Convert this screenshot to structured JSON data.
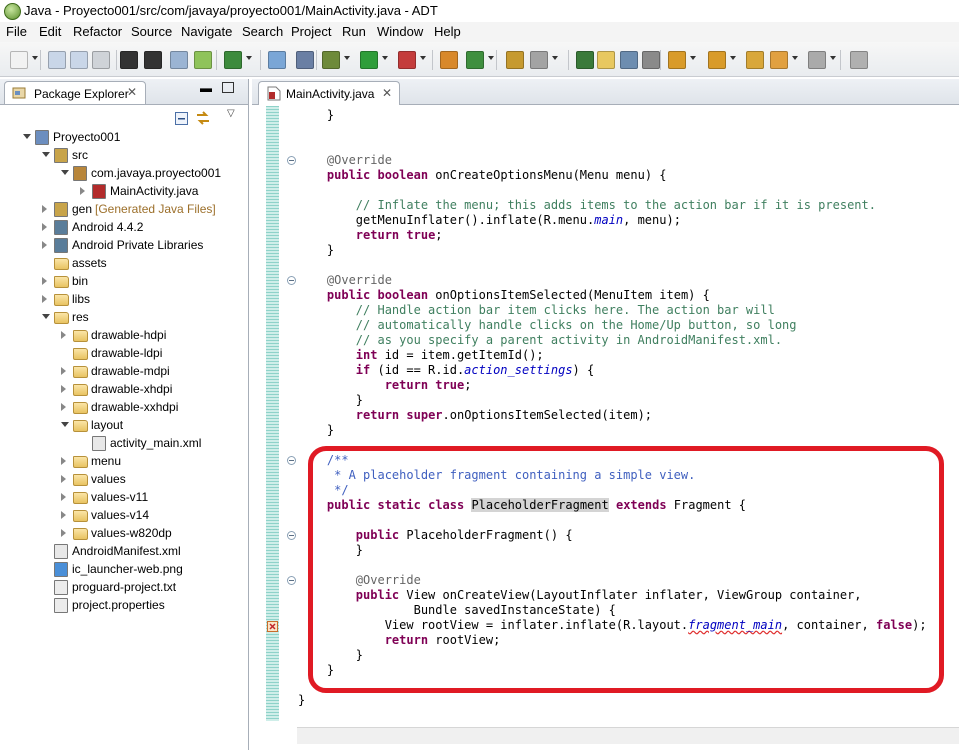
{
  "window": {
    "title": "Java - Proyecto001/src/com/javaya/proyecto001/MainActivity.java - ADT"
  },
  "menu": [
    {
      "label": "File",
      "ul": "F",
      "rest": "ile"
    },
    {
      "label": "Edit",
      "ul": "E",
      "rest": "dit"
    },
    {
      "label": "Refactor",
      "ul": "R",
      "rest": "efactor",
      "pre": ""
    },
    {
      "label": "Source",
      "ul": "S",
      "rest": "ource"
    },
    {
      "label": "Navigate",
      "ul": "N",
      "rest": "avigate"
    },
    {
      "label": "Search",
      "ul": "a",
      "rest": "rch",
      "pre": "Se"
    },
    {
      "label": "Project",
      "ul": "P",
      "rest": "roject"
    },
    {
      "label": "Run",
      "ul": "R",
      "rest": "un"
    },
    {
      "label": "Window",
      "ul": "W",
      "rest": "indow"
    },
    {
      "label": "Help",
      "ul": "H",
      "rest": "elp"
    }
  ],
  "package_explorer": {
    "title": "Package Explorer",
    "items": [
      {
        "label": "Proyecto001",
        "indent": 0,
        "twisty": "open",
        "icon": "project-icon"
      },
      {
        "label": "src",
        "indent": 1,
        "twisty": "open",
        "icon": "source-folder-icon"
      },
      {
        "label": "com.javaya.proyecto001",
        "indent": 2,
        "twisty": "open",
        "icon": "package-icon"
      },
      {
        "label": "MainActivity.java",
        "indent": 3,
        "twisty": "closed",
        "icon": "java-file-icon"
      },
      {
        "label": "gen",
        "suffix": "[Generated Java Files]",
        "indent": 1,
        "twisty": "closed",
        "icon": "source-folder-icon"
      },
      {
        "label": "Android 4.4.2",
        "indent": 1,
        "twisty": "closed",
        "icon": "library-icon"
      },
      {
        "label": "Android Private Libraries",
        "indent": 1,
        "twisty": "closed",
        "icon": "library-icon"
      },
      {
        "label": "assets",
        "indent": 1,
        "twisty": "",
        "icon": "folder-icon"
      },
      {
        "label": "bin",
        "indent": 1,
        "twisty": "closed",
        "icon": "folder-icon"
      },
      {
        "label": "libs",
        "indent": 1,
        "twisty": "closed",
        "icon": "folder-icon"
      },
      {
        "label": "res",
        "indent": 1,
        "twisty": "open",
        "icon": "folder-icon"
      },
      {
        "label": "drawable-hdpi",
        "indent": 2,
        "twisty": "closed",
        "icon": "folder-icon"
      },
      {
        "label": "drawable-ldpi",
        "indent": 2,
        "twisty": "",
        "icon": "folder-icon"
      },
      {
        "label": "drawable-mdpi",
        "indent": 2,
        "twisty": "closed",
        "icon": "folder-icon"
      },
      {
        "label": "drawable-xhdpi",
        "indent": 2,
        "twisty": "closed",
        "icon": "folder-icon"
      },
      {
        "label": "drawable-xxhdpi",
        "indent": 2,
        "twisty": "closed",
        "icon": "folder-icon"
      },
      {
        "label": "layout",
        "indent": 2,
        "twisty": "open",
        "icon": "folder-icon"
      },
      {
        "label": "activity_main.xml",
        "indent": 3,
        "twisty": "",
        "icon": "xml-file-icon"
      },
      {
        "label": "menu",
        "indent": 2,
        "twisty": "closed",
        "icon": "folder-icon"
      },
      {
        "label": "values",
        "indent": 2,
        "twisty": "closed",
        "icon": "folder-icon"
      },
      {
        "label": "values-v11",
        "indent": 2,
        "twisty": "closed",
        "icon": "folder-icon"
      },
      {
        "label": "values-v14",
        "indent": 2,
        "twisty": "closed",
        "icon": "folder-icon"
      },
      {
        "label": "values-w820dp",
        "indent": 2,
        "twisty": "closed",
        "icon": "folder-icon"
      },
      {
        "label": "AndroidManifest.xml",
        "indent": 1,
        "twisty": "",
        "icon": "xml-file-icon"
      },
      {
        "label": "ic_launcher-web.png",
        "indent": 1,
        "twisty": "",
        "icon": "image-file-icon"
      },
      {
        "label": "proguard-project.txt",
        "indent": 1,
        "twisty": "",
        "icon": "text-file-icon"
      },
      {
        "label": "project.properties",
        "indent": 1,
        "twisty": "",
        "icon": "text-file-icon"
      }
    ]
  },
  "editor": {
    "tab_label": "MainActivity.java",
    "code": [
      [
        [
          "    }",
          ""
        ]
      ],
      [],
      [],
      [
        [
          "    ",
          ""
        ],
        [
          "@Override",
          "an"
        ]
      ],
      [
        [
          "    ",
          ""
        ],
        [
          "public",
          "kw"
        ],
        [
          " ",
          ""
        ],
        [
          "boolean",
          "kw"
        ],
        [
          " onCreateOptionsMenu(Menu menu) {",
          ""
        ]
      ],
      [],
      [
        [
          "        ",
          ""
        ],
        [
          "// Inflate the menu; this adds items to the action bar if it is present.",
          "cm"
        ]
      ],
      [
        [
          "        getMenuInflater().inflate(R.menu.",
          ""
        ],
        [
          "main",
          "fi"
        ],
        [
          ", menu);",
          ""
        ]
      ],
      [
        [
          "        ",
          ""
        ],
        [
          "return",
          "kw"
        ],
        [
          " ",
          ""
        ],
        [
          "true",
          "kw"
        ],
        [
          ";",
          ""
        ]
      ],
      [
        [
          "    }",
          ""
        ]
      ],
      [],
      [
        [
          "    ",
          ""
        ],
        [
          "@Override",
          "an"
        ]
      ],
      [
        [
          "    ",
          ""
        ],
        [
          "public",
          "kw"
        ],
        [
          " ",
          ""
        ],
        [
          "boolean",
          "kw"
        ],
        [
          " onOptionsItemSelected(MenuItem item) {",
          ""
        ]
      ],
      [
        [
          "        ",
          ""
        ],
        [
          "// Handle action bar item clicks here. The action bar will",
          "cm"
        ]
      ],
      [
        [
          "        ",
          ""
        ],
        [
          "// automatically handle clicks on the Home/Up button, so long",
          "cm"
        ]
      ],
      [
        [
          "        ",
          ""
        ],
        [
          "// as you specify a parent activity in AndroidManifest.xml.",
          "cm"
        ]
      ],
      [
        [
          "        ",
          ""
        ],
        [
          "int",
          "kw"
        ],
        [
          " id = item.getItemId();",
          ""
        ]
      ],
      [
        [
          "        ",
          ""
        ],
        [
          "if",
          "kw"
        ],
        [
          " (id == R.id.",
          ""
        ],
        [
          "action_settings",
          "fi"
        ],
        [
          ") {",
          ""
        ]
      ],
      [
        [
          "            ",
          ""
        ],
        [
          "return",
          "kw"
        ],
        [
          " ",
          ""
        ],
        [
          "true",
          "kw"
        ],
        [
          ";",
          ""
        ]
      ],
      [
        [
          "        }",
          ""
        ]
      ],
      [
        [
          "        ",
          ""
        ],
        [
          "return",
          "kw"
        ],
        [
          " ",
          ""
        ],
        [
          "super",
          "kw"
        ],
        [
          ".onOptionsItemSelected(item);",
          ""
        ]
      ],
      [
        [
          "    }",
          ""
        ]
      ],
      [],
      [
        [
          "    ",
          ""
        ],
        [
          "/**",
          "jd"
        ]
      ],
      [
        [
          "     ",
          ""
        ],
        [
          "* A placeholder fragment containing a simple view.",
          "jd"
        ]
      ],
      [
        [
          "     ",
          ""
        ],
        [
          "*/",
          "jd"
        ]
      ],
      [
        [
          "    ",
          ""
        ],
        [
          "public",
          "kw"
        ],
        [
          " ",
          ""
        ],
        [
          "static",
          "kw"
        ],
        [
          " ",
          ""
        ],
        [
          "class",
          "kw"
        ],
        [
          " ",
          ""
        ],
        [
          "PlaceholderFragment",
          "hl"
        ],
        [
          " ",
          ""
        ],
        [
          "extends",
          "kw"
        ],
        [
          " Fragment {",
          ""
        ]
      ],
      [],
      [
        [
          "        ",
          ""
        ],
        [
          "public",
          "kw"
        ],
        [
          " PlaceholderFragment() {",
          ""
        ]
      ],
      [
        [
          "        }",
          ""
        ]
      ],
      [],
      [
        [
          "        ",
          ""
        ],
        [
          "@Override",
          "an"
        ]
      ],
      [
        [
          "        ",
          ""
        ],
        [
          "public",
          "kw"
        ],
        [
          " View onCreateView(LayoutInflater inflater, ViewGroup container,",
          ""
        ]
      ],
      [
        [
          "                Bundle savedInstanceState) {",
          ""
        ]
      ],
      [
        [
          "            View rootView = inflater.inflate(R.layout.",
          ""
        ],
        [
          "fragment_main",
          "fisq"
        ],
        [
          ", container, ",
          ""
        ],
        [
          "false",
          "kw"
        ],
        [
          ");",
          ""
        ]
      ],
      [
        [
          "            ",
          ""
        ],
        [
          "return",
          "kw"
        ],
        [
          " rootView;",
          ""
        ]
      ],
      [
        [
          "        }",
          ""
        ]
      ],
      [
        [
          "    }",
          ""
        ]
      ],
      [],
      [
        [
          "}",
          ""
        ]
      ]
    ]
  },
  "colors": {
    "keyword": "#7f0055",
    "comment": "#3f7f5f",
    "javadoc": "#3f5fbf",
    "annotation": "#646464",
    "field": "#0000c0",
    "highlight_box": "#e01a24"
  }
}
